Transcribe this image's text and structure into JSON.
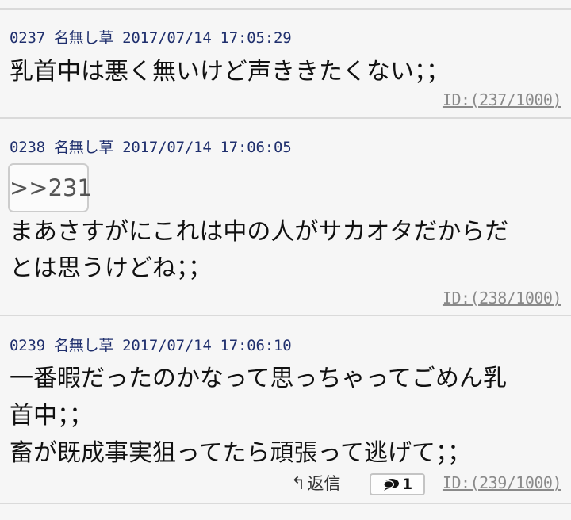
{
  "posts": [
    {
      "number": "0237",
      "name": "名無し草",
      "date": "2017/07/14",
      "time": "17:05:29",
      "lines": [
        "乳首中は悪く無いけど声ききたくない；；"
      ],
      "id": "ID:(237/1000)"
    },
    {
      "number": "0238",
      "name": "名無し草",
      "date": "2017/07/14",
      "time": "17:06:05",
      "anchor": ">>231",
      "lines": [
        "まあさすがにこれは中の人がサカオタだからだ",
        "とは思うけどね；；"
      ],
      "id": "ID:(238/1000)"
    },
    {
      "number": "0239",
      "name": "名無し草",
      "date": "2017/07/14",
      "time": "17:06:10",
      "lines": [
        "一番暇だったのかなって思っちゃってごめん乳",
        "首中；；",
        "畜が既成事実狙ってたら頑張って逃げて；；"
      ],
      "reply_label": "返信",
      "reply_icon": "reply-arrow-icon",
      "reply_count": "1",
      "reply_count_icon": "speech-bubble-icon",
      "id": "ID:(239/1000)"
    }
  ]
}
